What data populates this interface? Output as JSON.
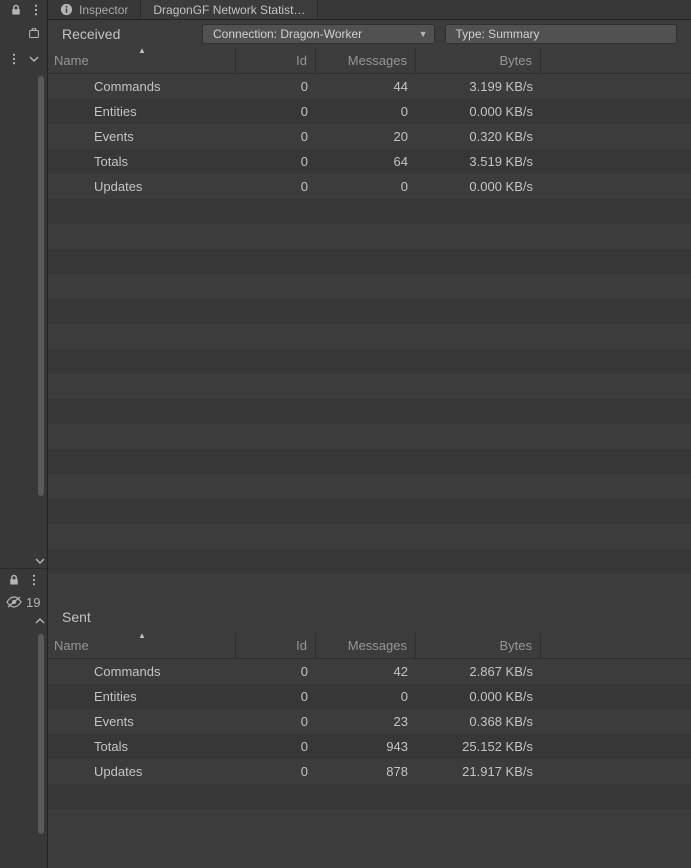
{
  "tabs": {
    "inspector": "Inspector",
    "network_stats": "DragonGF Network Statist…"
  },
  "toolbar": {
    "received_label": "Received",
    "connection_label": "Connection: Dragon-Worker",
    "type_label": "Type: Summary"
  },
  "columns": {
    "name": "Name",
    "id": "Id",
    "messages": "Messages",
    "bytes": "Bytes"
  },
  "received": {
    "rows": [
      {
        "name": "Commands",
        "id": "0",
        "messages": "44",
        "bytes": "3.199 KB/s"
      },
      {
        "name": "Entities",
        "id": "0",
        "messages": "0",
        "bytes": "0.000 KB/s"
      },
      {
        "name": "Events",
        "id": "0",
        "messages": "20",
        "bytes": "0.320 KB/s"
      },
      {
        "name": "Totals",
        "id": "0",
        "messages": "64",
        "bytes": "3.519 KB/s"
      },
      {
        "name": "Updates",
        "id": "0",
        "messages": "0",
        "bytes": "0.000 KB/s"
      }
    ]
  },
  "sent": {
    "label": "Sent",
    "rows": [
      {
        "name": "Commands",
        "id": "0",
        "messages": "42",
        "bytes": "2.867 KB/s"
      },
      {
        "name": "Entities",
        "id": "0",
        "messages": "0",
        "bytes": "0.000 KB/s"
      },
      {
        "name": "Events",
        "id": "0",
        "messages": "23",
        "bytes": "0.368 KB/s"
      },
      {
        "name": "Totals",
        "id": "0",
        "messages": "943",
        "bytes": "25.152 KB/s"
      },
      {
        "name": "Updates",
        "id": "0",
        "messages": "878",
        "bytes": "21.917 KB/s"
      }
    ]
  },
  "rail": {
    "visibility_count": "19"
  }
}
